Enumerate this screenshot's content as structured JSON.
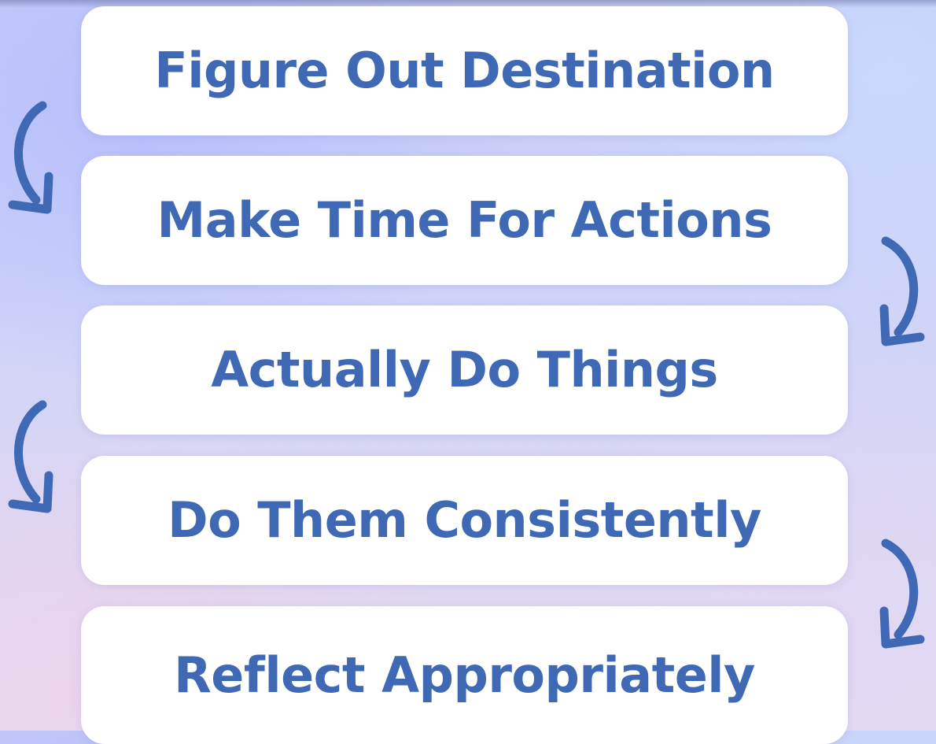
{
  "steps": [
    {
      "label": "Figure Out Destination"
    },
    {
      "label": "Make Time For Actions"
    },
    {
      "label": "Actually Do Things"
    },
    {
      "label": "Do Them Consistently"
    },
    {
      "label": "Reflect Appropriately"
    }
  ],
  "colors": {
    "text": "#3f69b4",
    "arrow": "#3f69b4",
    "card": "#ffffff"
  },
  "arrows": [
    {
      "icon": "curved-arrow-down-icon",
      "side": "left"
    },
    {
      "icon": "curved-arrow-down-icon",
      "side": "right"
    },
    {
      "icon": "curved-arrow-down-icon",
      "side": "left"
    },
    {
      "icon": "curved-arrow-down-icon",
      "side": "right"
    }
  ]
}
